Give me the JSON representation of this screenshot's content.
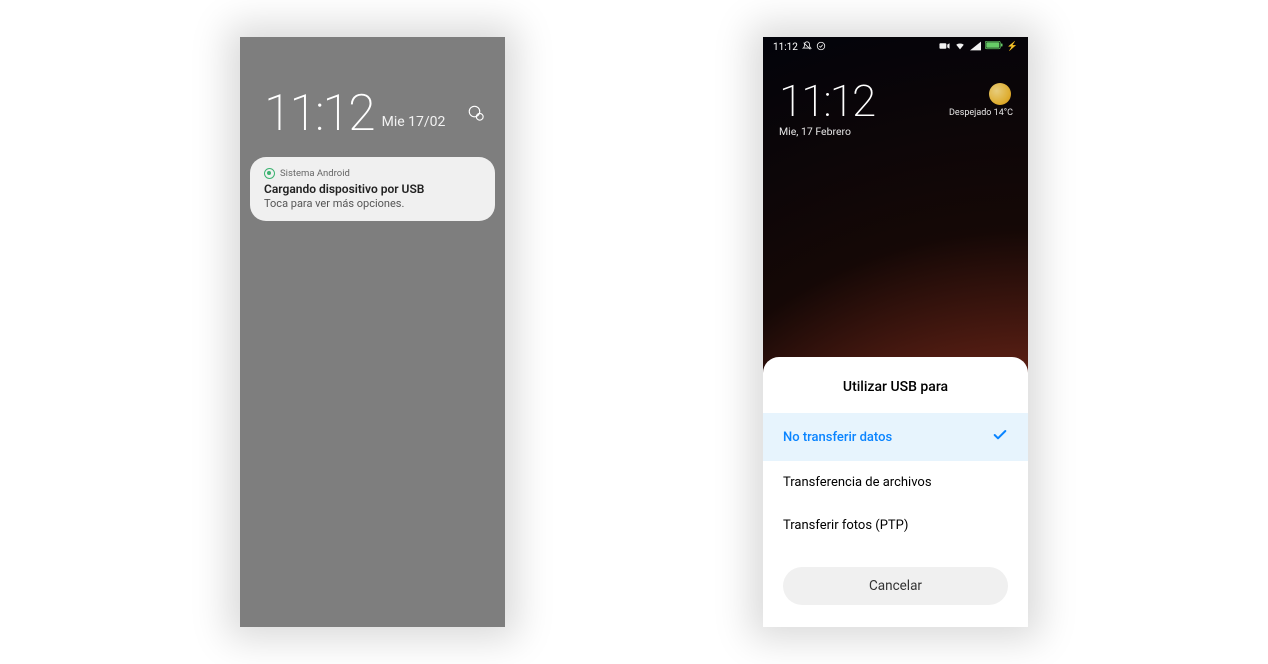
{
  "left_phone": {
    "time": "11:12",
    "date": "Mie 17/02",
    "notification": {
      "app_name": "Sistema Android",
      "title": "Cargando dispositivo por USB",
      "body": "Toca para ver más opciones."
    }
  },
  "right_phone": {
    "status_time": "11:12",
    "time": "11:12",
    "date": "Mie, 17 Febrero",
    "weather": {
      "label": "Despejado  14°C"
    },
    "sheet": {
      "title": "Utilizar USB para",
      "options": [
        {
          "label": "No transferir datos",
          "selected": true
        },
        {
          "label": "Transferencia de archivos",
          "selected": false
        },
        {
          "label": "Transferir fotos (PTP)",
          "selected": false
        }
      ],
      "cancel": "Cancelar"
    }
  }
}
